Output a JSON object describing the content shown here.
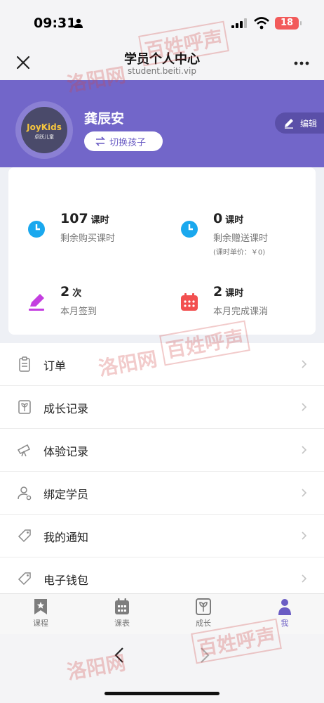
{
  "status_bar": {
    "time": "09:31",
    "battery": "18"
  },
  "nav": {
    "title": "学员个人中心",
    "url": "student.beiti.vip"
  },
  "profile": {
    "name": "龚辰安",
    "switch_label": "切换孩子",
    "edit_label": "编辑",
    "avatar_logo": "JoyKids",
    "avatar_logo_sub": "卓跃儿童"
  },
  "stats": [
    {
      "number": "107",
      "unit": "课时",
      "label": "剩余购买课时",
      "note": "",
      "icon": "clock-icon",
      "color": "#1aa8ee"
    },
    {
      "number": "0",
      "unit": "课时",
      "label": "剩余赠送课时",
      "note": "(课时单价：￥0)",
      "icon": "clock-icon",
      "color": "#1aa8ee"
    },
    {
      "number": "2",
      "unit": "次",
      "label": "本月签到",
      "note": "",
      "icon": "pencil-icon",
      "color": "#c43ee0"
    },
    {
      "number": "2",
      "unit": "课时",
      "label": "本月完成课消",
      "note": "",
      "icon": "calendar-icon",
      "color": "#f25050"
    }
  ],
  "menu": [
    {
      "label": "订单",
      "icon": "clipboard-icon"
    },
    {
      "label": "成长记录",
      "icon": "sprout-icon"
    },
    {
      "label": "体验记录",
      "icon": "telescope-icon"
    },
    {
      "label": "绑定学员",
      "icon": "user-link-icon"
    },
    {
      "label": "我的通知",
      "icon": "tag-icon"
    },
    {
      "label": "电子钱包",
      "icon": "tag-icon"
    }
  ],
  "tabs": [
    {
      "label": "课程",
      "icon": "bookmark-star-icon"
    },
    {
      "label": "课表",
      "icon": "calendar-grid-icon"
    },
    {
      "label": "成长",
      "icon": "sprout-icon"
    },
    {
      "label": "我",
      "icon": "person-icon",
      "active": true
    }
  ],
  "watermarks": [
    "洛阳网",
    "百姓呼声"
  ],
  "colors": {
    "header": "#7266c9",
    "accent": "#6a5cc4"
  }
}
